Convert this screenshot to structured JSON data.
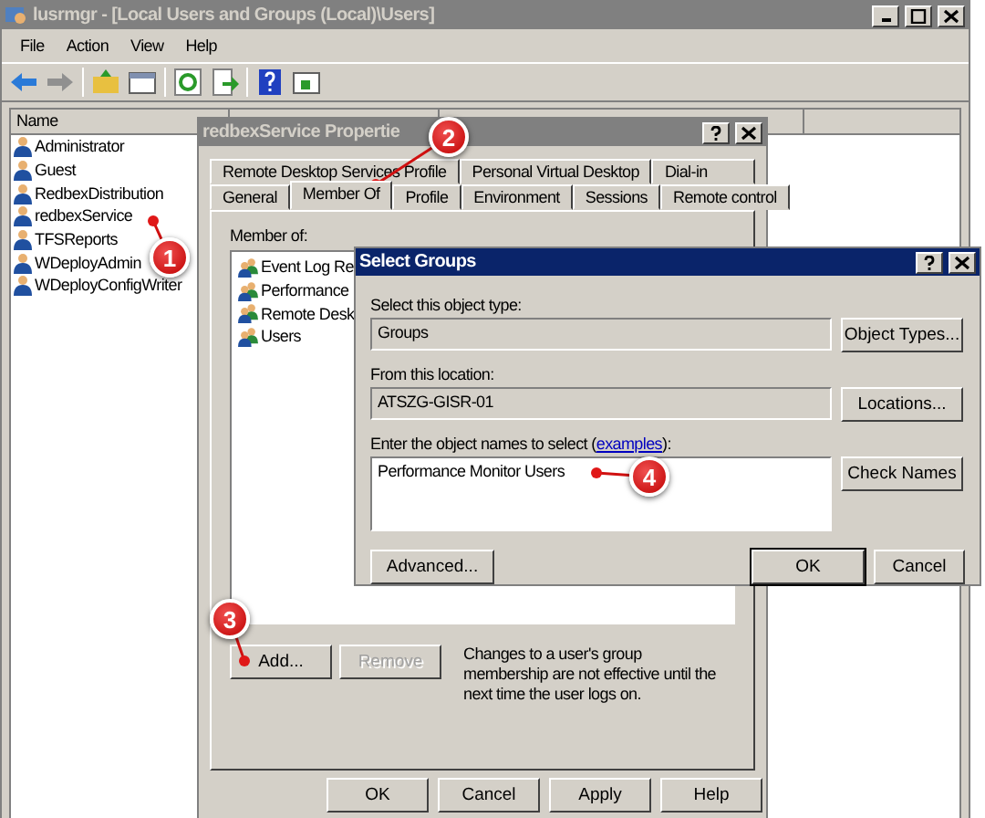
{
  "main_window": {
    "title": "lusrmgr - [Local Users and Groups (Local)\\Users]",
    "menu": [
      "File",
      "Action",
      "View",
      "Help"
    ],
    "list": {
      "column": "Name",
      "items": [
        "Administrator",
        "Guest",
        "RedbexDistribution",
        "redbexService",
        "TFSReports",
        "WDeployAdmin",
        "WDeployConfigWriter"
      ]
    }
  },
  "properties_dialog": {
    "title": "redbexService Propertie",
    "tab_rows": [
      [
        {
          "label": "Remote Desktop Services Profile",
          "selected": false
        },
        {
          "label": "Personal Virtual Desktop",
          "selected": false
        },
        {
          "label": "Dial-in",
          "selected": false
        }
      ],
      [
        {
          "label": "General",
          "selected": false
        },
        {
          "label": "Member Of",
          "selected": true
        },
        {
          "label": "Profile",
          "selected": false
        },
        {
          "label": "Environment",
          "selected": false
        },
        {
          "label": "Sessions",
          "selected": false
        },
        {
          "label": "Remote control",
          "selected": false
        }
      ]
    ],
    "member_of_label": "Member of:",
    "groups": [
      "Event Log Re",
      "Performance",
      "Remote Desk",
      "Users"
    ],
    "actions": [
      {
        "label": "Add...",
        "disabled": false
      },
      {
        "label": "Remove",
        "disabled": true
      }
    ],
    "note": "Changes to a user's group membership are not effective until the next time the user logs on.",
    "footer": [
      {
        "label": "OK",
        "disabled": false
      },
      {
        "label": "Cancel",
        "disabled": false
      },
      {
        "label": "Apply",
        "disabled": false
      },
      {
        "label": "Help",
        "disabled": false
      }
    ]
  },
  "select_groups": {
    "title": "Select Groups",
    "object_type_label": "Select this object type:",
    "object_type": "Groups",
    "object_types_button": "Object Types...",
    "location_label": "From this location:",
    "location": "ATSZG-GISR-01",
    "locations_button": "Locations...",
    "names_label_before": "Enter the object names to select (",
    "names_link": "examples",
    "names_label_after": "):",
    "names_value": "Performance Monitor Users",
    "check_names_button": "Check Names",
    "advanced_button": "Advanced...",
    "ok_button": "OK",
    "cancel_button": "Cancel"
  },
  "callouts": [
    "1",
    "2",
    "3",
    "4"
  ]
}
